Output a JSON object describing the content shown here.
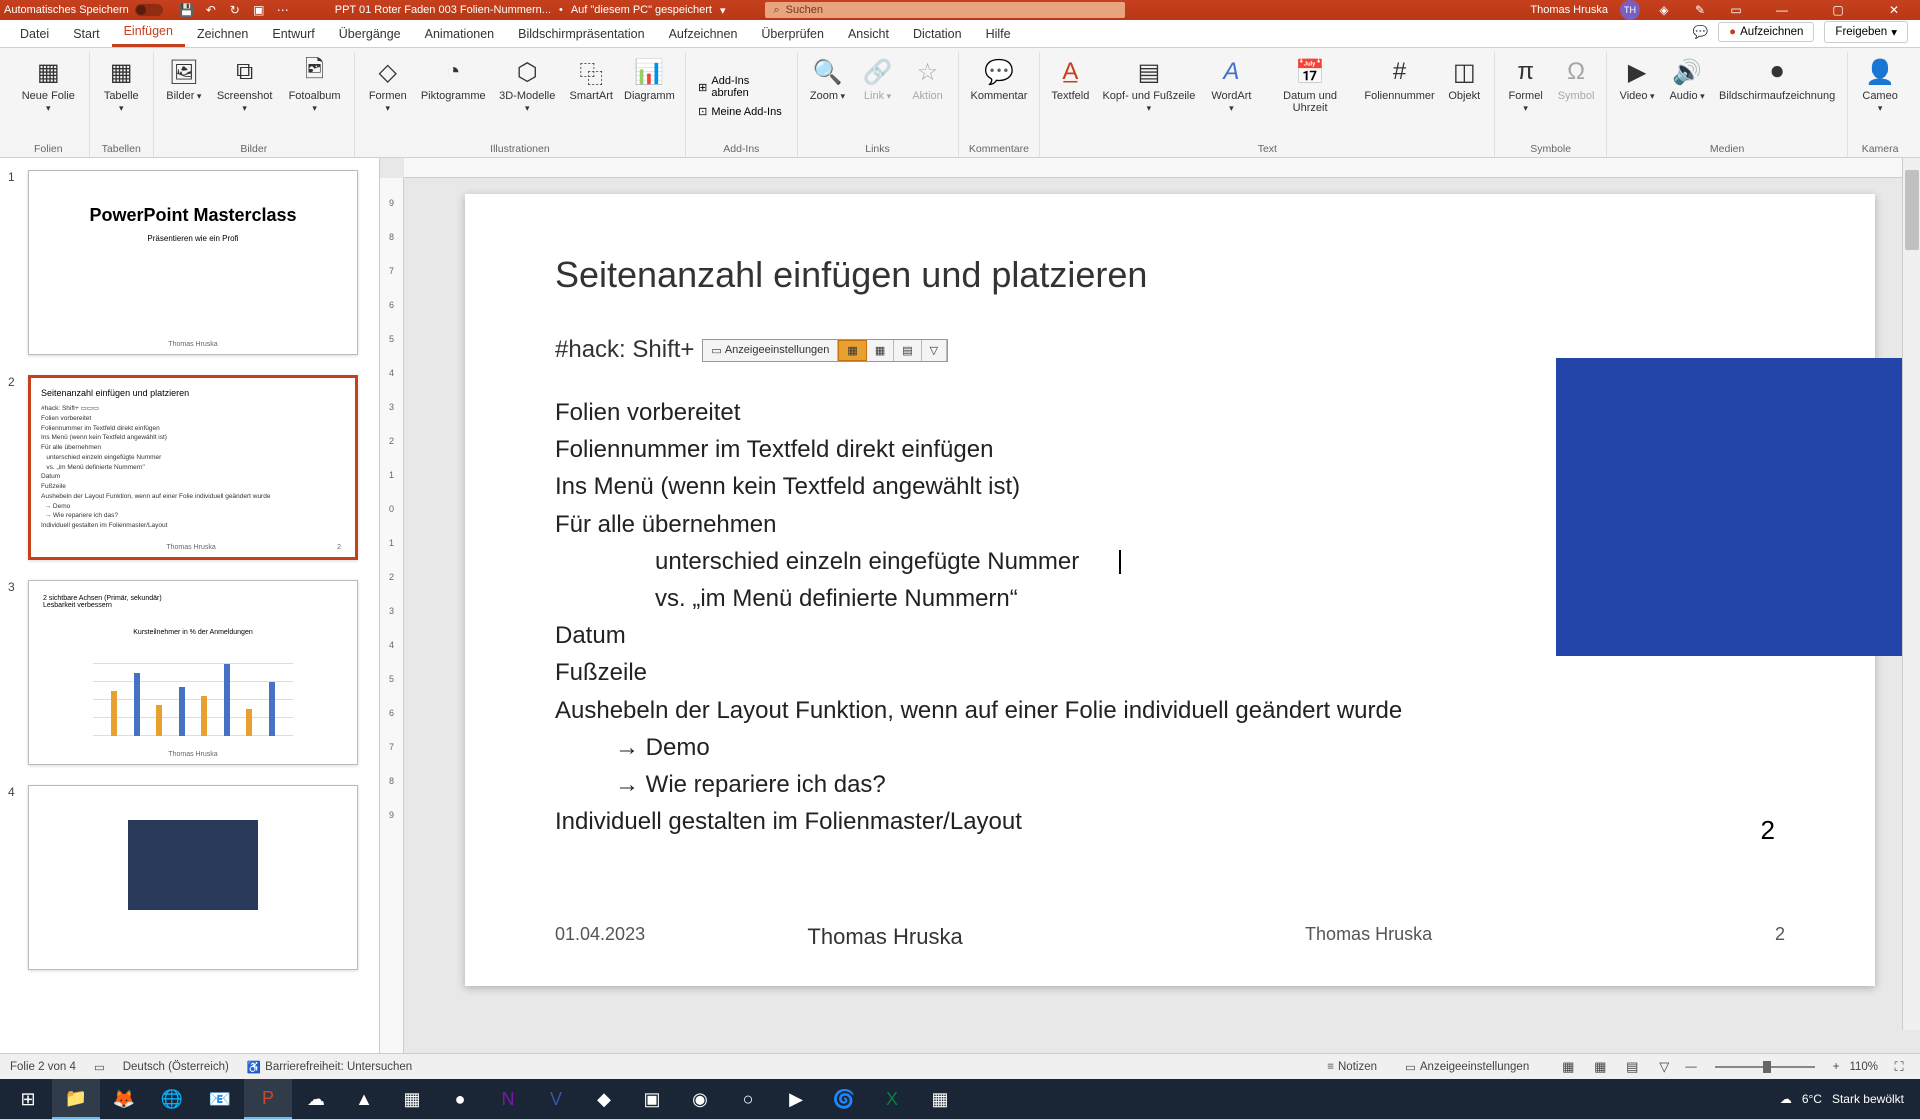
{
  "titlebar": {
    "autosave": "Automatisches Speichern",
    "doc_name": "PPT 01 Roter Faden 003 Folien-Nummern...",
    "save_location": "Auf \"diesem PC\" gespeichert",
    "search_placeholder": "Suchen",
    "user_name": "Thomas Hruska",
    "user_initials": "TH"
  },
  "tabs": {
    "datei": "Datei",
    "start": "Start",
    "einfuegen": "Einfügen",
    "zeichnen": "Zeichnen",
    "entwurf": "Entwurf",
    "uebergaenge": "Übergänge",
    "animationen": "Animationen",
    "bildschirm": "Bildschirmpräsentation",
    "aufzeichnen": "Aufzeichnen",
    "ueberpruefen": "Überprüfen",
    "ansicht": "Ansicht",
    "dictation": "Dictation",
    "hilfe": "Hilfe",
    "aufzeichnen_btn": "Aufzeichnen",
    "freigeben": "Freigeben"
  },
  "ribbon": {
    "neue_folie": "Neue Folie",
    "folien": "Folien",
    "tabelle": "Tabelle",
    "tabellen": "Tabellen",
    "bilder": "Bilder",
    "screenshot": "Screenshot",
    "fotoalbum": "Fotoalbum",
    "bilder_grp": "Bilder",
    "formen": "Formen",
    "piktogramme": "Piktogramme",
    "modelle": "3D-Modelle",
    "smartart": "SmartArt",
    "diagramm": "Diagramm",
    "illustrationen": "Illustrationen",
    "addins_abrufen": "Add-Ins abrufen",
    "meine_addins": "Meine Add-Ins",
    "addins": "Add-Ins",
    "zoom": "Zoom",
    "link": "Link",
    "aktion": "Aktion",
    "links": "Links",
    "kommentar": "Kommentar",
    "kommentare": "Kommentare",
    "textfeld": "Textfeld",
    "kopf_fuss": "Kopf- und Fußzeile",
    "wordart": "WordArt",
    "datum_uhrzeit": "Datum und Uhrzeit",
    "foliennummer": "Foliennummer",
    "objekt": "Objekt",
    "text": "Text",
    "formel": "Formel",
    "symbol": "Symbol",
    "symbole": "Symbole",
    "video": "Video",
    "audio": "Audio",
    "bildschirmaufz": "Bildschirmaufzeichnung",
    "medien": "Medien",
    "cameo": "Cameo",
    "kamera": "Kamera"
  },
  "thumbs": {
    "t1": {
      "num": "1",
      "title": "PowerPoint Masterclass",
      "sub": "Präsentieren wie ein Profi",
      "footer": "Thomas Hruska"
    },
    "t2": {
      "num": "2",
      "title": "Seitenanzahl einfügen und platzieren",
      "footer": "Thomas Hruska",
      "page": "2"
    },
    "t3": {
      "num": "3",
      "footer": "Thomas Hruska"
    },
    "t4": {
      "num": "4"
    }
  },
  "slide": {
    "title": "Seitenanzahl einfügen und platzieren",
    "hack_prefix": "#hack: Shift+",
    "toolbar_label": "Anzeigeeinstellungen",
    "lines": {
      "l1": "Folien vorbereitet",
      "l2": "Foliennummer im Textfeld direkt einfügen",
      "l3": "Ins Menü (wenn kein Textfeld angewählt ist)",
      "l4": "Für alle übernehmen",
      "l5": "unterschied  einzeln eingefügte Nummer",
      "l6": "vs. „im Menü definierte Nummern“",
      "l7": "Datum",
      "l8": "Fußzeile",
      "l9": "Aushebeln der Layout Funktion, wenn auf einer Folie individuell geändert wurde",
      "l10": "Demo",
      "l11": "Wie repariere ich das?",
      "l12": "Individuell gestalten im Folienmaster/Layout"
    },
    "pagenum": "2",
    "footer_date": "01.04.2023",
    "footer_center": "Thomas Hruska",
    "footer_right": "Thomas Hruska",
    "footer_page": "2"
  },
  "statusbar": {
    "slide_count": "Folie 2 von 4",
    "lang": "Deutsch (Österreich)",
    "access": "Barrierefreiheit: Untersuchen",
    "notizen": "Notizen",
    "anzeige": "Anzeigeeinstellungen",
    "zoom": "110%"
  },
  "taskbar": {
    "weather_temp": "6°C",
    "weather_desc": "Stark bewölkt"
  }
}
